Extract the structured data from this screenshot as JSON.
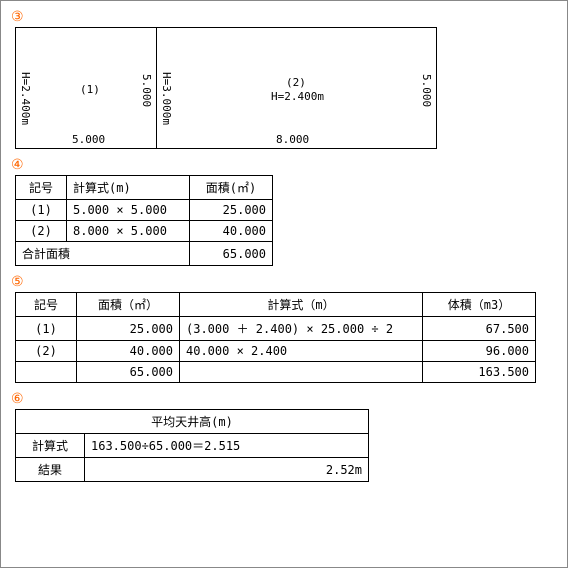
{
  "sections": {
    "s3": "③",
    "s4": "④",
    "s5": "⑤",
    "s6": "⑥"
  },
  "diagram": {
    "leftH": "H=2.400m",
    "leftW": "5.000",
    "leftSide": "5.000",
    "midH": "H=3.000m",
    "region1": "(1)",
    "region2": "(2)",
    "region2H": "H=2.400m",
    "rightSide": "5.000",
    "rightW": "8.000"
  },
  "table4": {
    "h1": "記号",
    "h2": "計算式(m)",
    "h3": "面積(㎡)",
    "r1c1": "(1)",
    "r1c2": "5.000 × 5.000",
    "r1c3": "25.000",
    "r2c1": "(2)",
    "r2c2": "8.000 × 5.000",
    "r2c3": "40.000",
    "sumLabel": "合計面積",
    "sumVal": "65.000"
  },
  "table5": {
    "h1": "記号",
    "h2": "面積（㎡）",
    "h3": "計算式（m）",
    "h4": "体積（m3）",
    "r1c1": "(1)",
    "r1c2": "25.000",
    "r1c3": "(3.000 ＋ 2.400) × 25.000 ÷ 2",
    "r1c4": "67.500",
    "r2c1": "(2)",
    "r2c2": "40.000",
    "r2c3": "40.000 × 2.400",
    "r2c4": "96.000",
    "r3c2": "65.000",
    "r3c4": "163.500"
  },
  "table6": {
    "title": "平均天井高(m)",
    "r1c1": "計算式",
    "r1c2": "163.500÷65.000＝2.515",
    "r2c1": "結果",
    "r2c2": "2.52m"
  }
}
